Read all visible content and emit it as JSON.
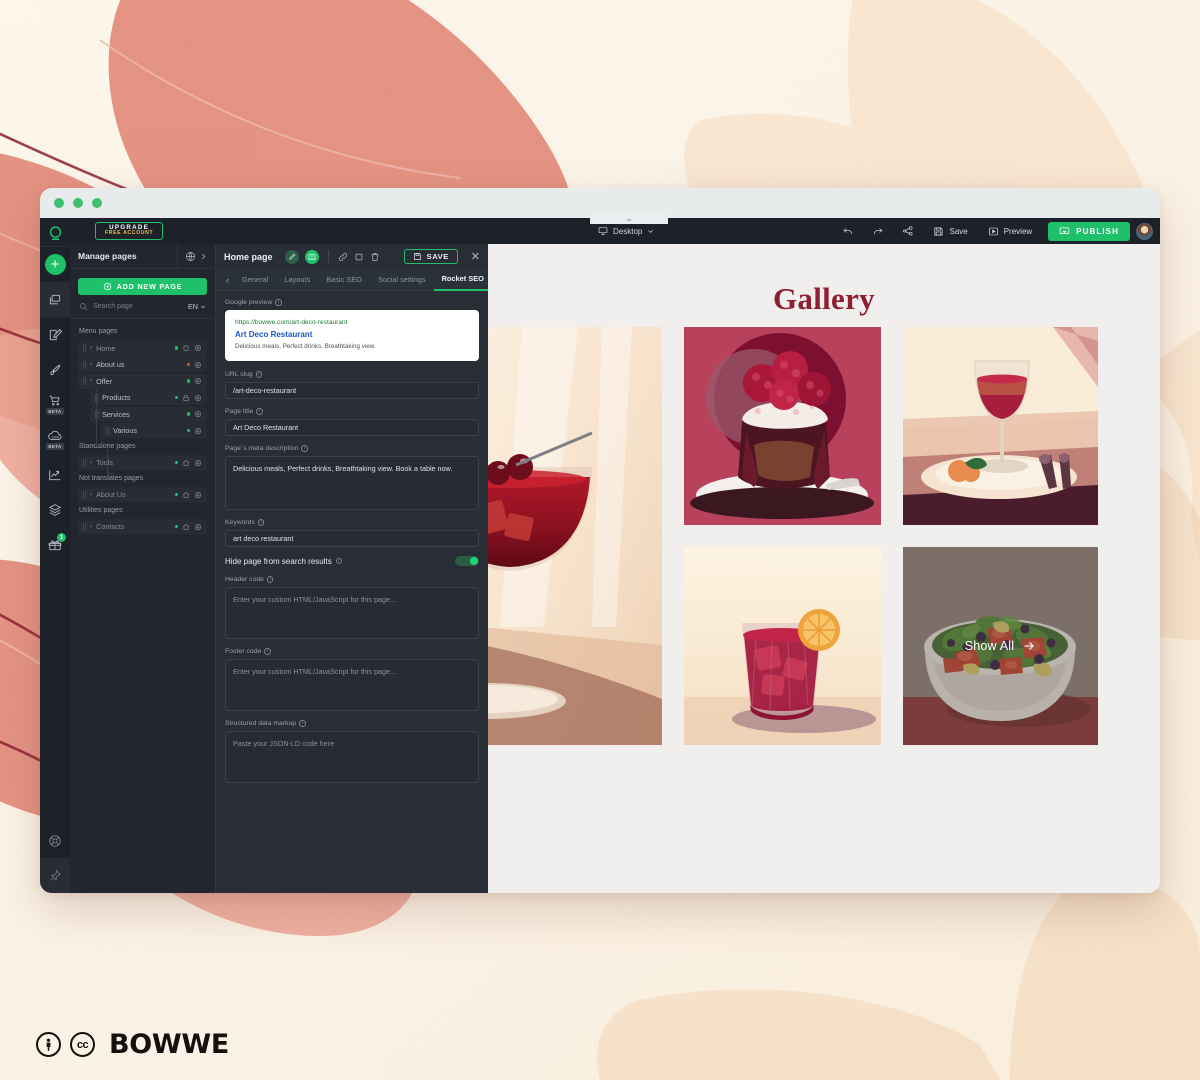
{
  "window": {
    "traffic_lights": [
      "green",
      "green",
      "green"
    ]
  },
  "rail": {
    "logo": "bowwe-logo",
    "items": [
      {
        "name": "add-new",
        "icon": "plus-icon",
        "label": "",
        "badge": ""
      },
      {
        "name": "pages",
        "icon": "pages-stack-icon",
        "label": "",
        "badge": "",
        "active": true
      },
      {
        "name": "editor",
        "icon": "pencil-square-icon",
        "label": "",
        "badge": ""
      },
      {
        "name": "design",
        "icon": "paint-brush-icon",
        "label": "",
        "badge": ""
      },
      {
        "name": "store",
        "icon": "shopping-cart-icon",
        "label": "BETA",
        "badge": ""
      },
      {
        "name": "crm",
        "icon": "crm-cloud-icon",
        "label": "BETA",
        "badge": ""
      },
      {
        "name": "analytics",
        "icon": "line-chart-icon",
        "label": "",
        "badge": ""
      },
      {
        "name": "layers",
        "icon": "layers-icon",
        "label": "",
        "badge": ""
      },
      {
        "name": "rewards",
        "icon": "gift-icon",
        "label": "",
        "badge": "1"
      },
      {
        "name": "support",
        "icon": "lifebuoy-icon",
        "label": "",
        "badge": ""
      },
      {
        "name": "pin",
        "icon": "pin-icon",
        "label": "",
        "badge": ""
      }
    ]
  },
  "topbar": {
    "upgrade_line1": "UPGRADE",
    "upgrade_line2": "FREE ACCOUNT",
    "device": "Desktop",
    "undo": "undo-icon",
    "redo": "redo-icon",
    "sitemap": "sitemap-icon",
    "save_label": "Save",
    "preview_label": "Preview",
    "publish_label": "PUBLISH"
  },
  "pages_panel": {
    "header_title": "Manage pages",
    "add_button": "ADD NEW PAGE",
    "search_placeholder": "Search page",
    "language": "EN",
    "groups": [
      {
        "label": "Menu pages",
        "items": [
          {
            "name": "Home",
            "status": "green",
            "indent": 0,
            "has_chevron": true,
            "home_icon": true,
            "dim": true
          },
          {
            "name": "About us",
            "status": "red",
            "indent": 0,
            "has_chevron": true,
            "home_icon": false,
            "dim": false
          },
          {
            "name": "Offer",
            "status": "green",
            "indent": 0,
            "has_chevron": true,
            "home_icon": false,
            "dim": false
          },
          {
            "name": "Products",
            "status": "green",
            "indent": 1,
            "has_chevron": false,
            "lock_icon": true,
            "dim": false
          },
          {
            "name": "Services",
            "status": "green",
            "indent": 1,
            "has_chevron": false,
            "home_icon": false,
            "dim": false
          },
          {
            "name": "Various",
            "status": "green",
            "indent": 2,
            "has_chevron": false,
            "home_icon": false,
            "dim": false
          }
        ]
      },
      {
        "label": "Standalone pages",
        "items": [
          {
            "name": "Tools",
            "status": "green",
            "indent": 0,
            "has_chevron": true,
            "home_icon": true,
            "dim": true
          }
        ]
      },
      {
        "label": "Not translates pages",
        "items": [
          {
            "name": "About Us",
            "status": "green",
            "indent": 0,
            "has_chevron": true,
            "home_icon": true,
            "dim": true
          }
        ]
      },
      {
        "label": "Utilities pages",
        "items": [
          {
            "name": "Contacts",
            "status": "green",
            "indent": 0,
            "has_chevron": true,
            "home_icon": true,
            "dim": true
          }
        ]
      }
    ]
  },
  "seo_panel": {
    "page_name": "Home page",
    "save_label": "SAVE",
    "tabs": [
      {
        "label": "General",
        "active": false
      },
      {
        "label": "Layouts",
        "active": false
      },
      {
        "label": "Basic SEO",
        "active": false
      },
      {
        "label": "Social settings",
        "active": false
      },
      {
        "label": "Rocket SEO",
        "active": true
      }
    ],
    "google_preview": {
      "label": "Google preview",
      "url": "https://bowwe.com/art-deco-restaurant",
      "title": "Art Deco Restaurant",
      "description": "Delicious meals, Perfect drinks, Breathtaking view."
    },
    "fields": {
      "url_slug_label": "URL slug",
      "url_slug_value": "/art-deco-restaurant",
      "page_title_label": "Page title",
      "page_title_value": "Art Deco Restaurant",
      "meta_desc_label": "Page`s meta description",
      "meta_desc_value": "Delicious meals, Perfect drinks, Breathtaking view. Book a table now.",
      "keywords_label": "Keywords",
      "keywords_value": "art deco restaurant",
      "hide_page_label": "Hide page from search results",
      "hide_page_enabled": true,
      "header_code_label": "Header code",
      "header_code_placeholder": "Enter your custom HTML/JavaScript for this page...",
      "footer_code_label": "Footer code",
      "footer_code_placeholder": "Enter your custom HTML/JavaScript for this page...",
      "structured_label": "Structured data markup",
      "structured_placeholder": "Paste your JSON-LD code here"
    }
  },
  "canvas": {
    "heading": "Gallery",
    "show_all_label": "Show All",
    "tiles": [
      {
        "name": "cocktail-cherries-tile",
        "alt": "Red cocktail with cherries"
      },
      {
        "name": "chocolate-raspberry-cake-tile",
        "alt": "Chocolate cake with raspberries"
      },
      {
        "name": "wine-glass-tile",
        "alt": "Glass of red wine on table"
      },
      {
        "name": "orange-cocktail-tile",
        "alt": "Cocktail with orange slice"
      },
      {
        "name": "salad-bowl-tile",
        "alt": "Fresh salad bowl"
      }
    ]
  },
  "footer": {
    "brand": "BOWWE",
    "license_by": "cc-by-icon",
    "license_cc": "cc-icon"
  },
  "colors": {
    "accent_green": "#1fc06a",
    "panel_dark": "#282d36",
    "sidebar_dark": "#22262e",
    "rail_dark": "#1d2129",
    "gallery_heading": "#8e1f30",
    "google_url": "#1a7a3c",
    "google_title": "#1a56c4",
    "status_red": "#e0523f"
  }
}
